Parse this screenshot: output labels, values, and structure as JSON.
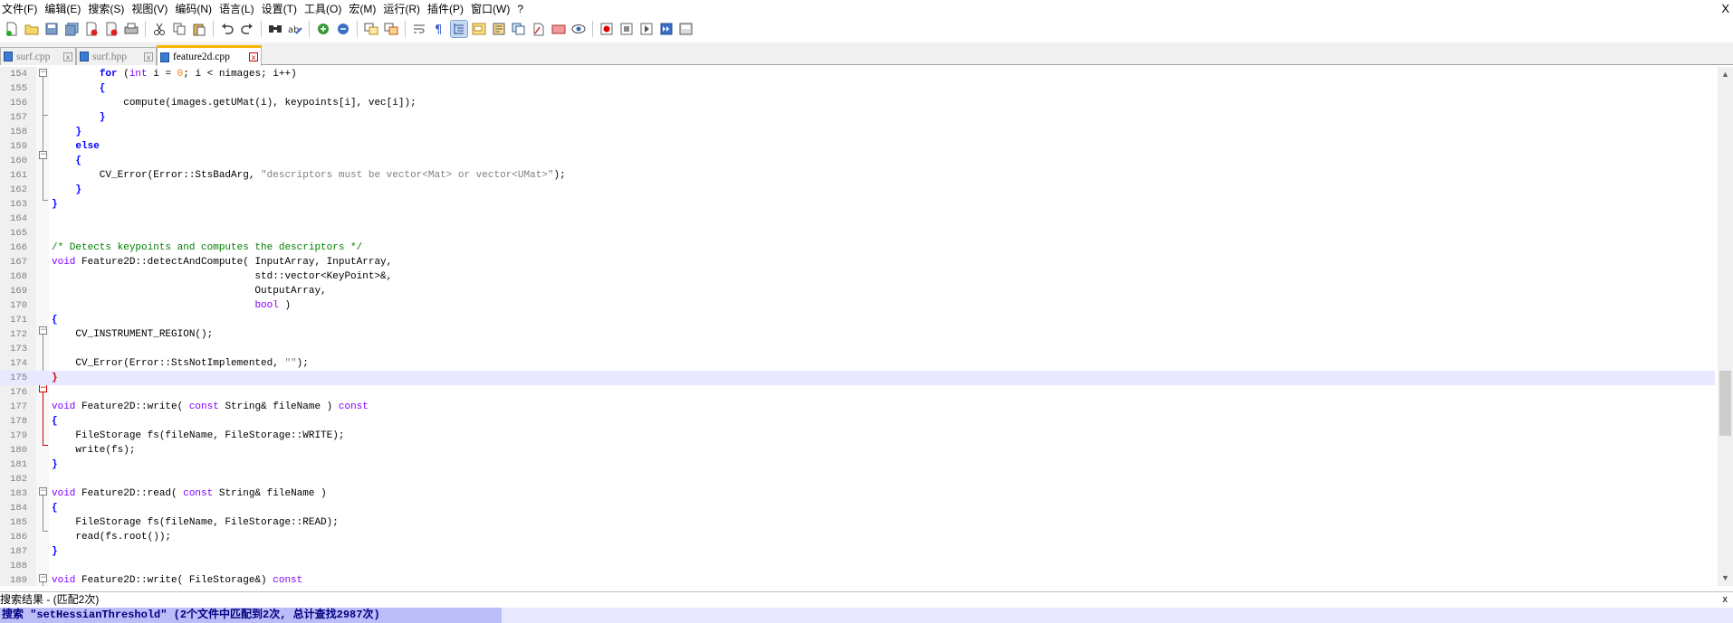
{
  "menubar": {
    "items": [
      "文件(F)",
      "编辑(E)",
      "搜索(S)",
      "视图(V)",
      "编码(N)",
      "语言(L)",
      "设置(T)",
      "工具(O)",
      "宏(M)",
      "运行(R)",
      "插件(P)",
      "窗口(W)",
      "?"
    ],
    "close_label": "X"
  },
  "tabs": [
    {
      "label": "surf.cpp",
      "close": "x"
    },
    {
      "label": "surf.hpp",
      "close": "x"
    },
    {
      "label": "feature2d.cpp",
      "close": "x"
    }
  ],
  "editor": {
    "line_numbers": [
      "154",
      "155",
      "156",
      "157",
      "158",
      "159",
      "160",
      "161",
      "162",
      "163",
      "164",
      "165",
      "166",
      "167",
      "168",
      "169",
      "170",
      "171",
      "172",
      "173",
      "174",
      "175",
      "176",
      "177",
      "178",
      "179",
      "180",
      "181",
      "182",
      "183",
      "184",
      "185",
      "186",
      "187",
      "188",
      "189"
    ],
    "current_line": "175",
    "code": {
      "l154": {
        "t1": "        ",
        "kw": "for",
        "t2": " (",
        "ty": "int",
        "t3": " i = ",
        "num": "0",
        "t4": "; i < nimages; i++)"
      },
      "l155": "        {",
      "l156": "            compute(images.getUMat(i), keypoints[i], vec[i]);",
      "l157": "        }",
      "l158": "    }",
      "l159": {
        "t1": "    ",
        "kw": "else"
      },
      "l160": "    {",
      "l161": {
        "t1": "        CV_Error(Error::StsBadArg, ",
        "str": "\"descriptors must be vector<Mat> or vector<UMat>\"",
        "t2": ");"
      },
      "l162": "    }",
      "l163": "}",
      "l166": "/* Detects keypoints and computes the descriptors */",
      "l167": {
        "ty": "void",
        "t1": " Feature2D::detectAndCompute( InputArray, InputArray,"
      },
      "l168": "                                  std::vector<KeyPoint>&,",
      "l169": "                                  OutputArray,",
      "l170": {
        "t1": "                                  ",
        "ty": "bool",
        "t2": " )"
      },
      "l171": "{",
      "l172": "    CV_INSTRUMENT_REGION();",
      "l174": {
        "t1": "    CV_Error(Error::StsNotImplemented, ",
        "str": "\"\"",
        "t2": ");"
      },
      "l175": "}",
      "l177": {
        "ty1": "void",
        "t1": " Feature2D::write( ",
        "ty2": "const",
        "t2": " String& fileName ) ",
        "ty3": "const"
      },
      "l178": "{",
      "l179": "    FileStorage fs(fileName, FileStorage::WRITE);",
      "l180": "    write(fs);",
      "l181": "}",
      "l183": {
        "ty1": "void",
        "t1": " Feature2D::read( ",
        "ty2": "const",
        "t2": " String& fileName )"
      },
      "l184": "{",
      "l185": "    FileStorage fs(fileName, FileStorage::READ);",
      "l186": "    read(fs.root());",
      "l187": "}",
      "l189": {
        "ty1": "void",
        "t1": " Feature2D::write( FileStorage&) ",
        "ty2": "const"
      }
    }
  },
  "search_results": {
    "title": "搜索结果 - (匹配2次)",
    "close_label": "x",
    "summary": "搜索 \"setHessianThreshold\" (2个文件中匹配到2次, 总计查找2987次)"
  },
  "colors": {
    "keyword": "#0000ff",
    "type": "#8000ff",
    "comment": "#008000",
    "string": "#808080",
    "number": "#ff8000",
    "current_line": "#e8e8ff",
    "active_tab_accent": "#fab400"
  }
}
